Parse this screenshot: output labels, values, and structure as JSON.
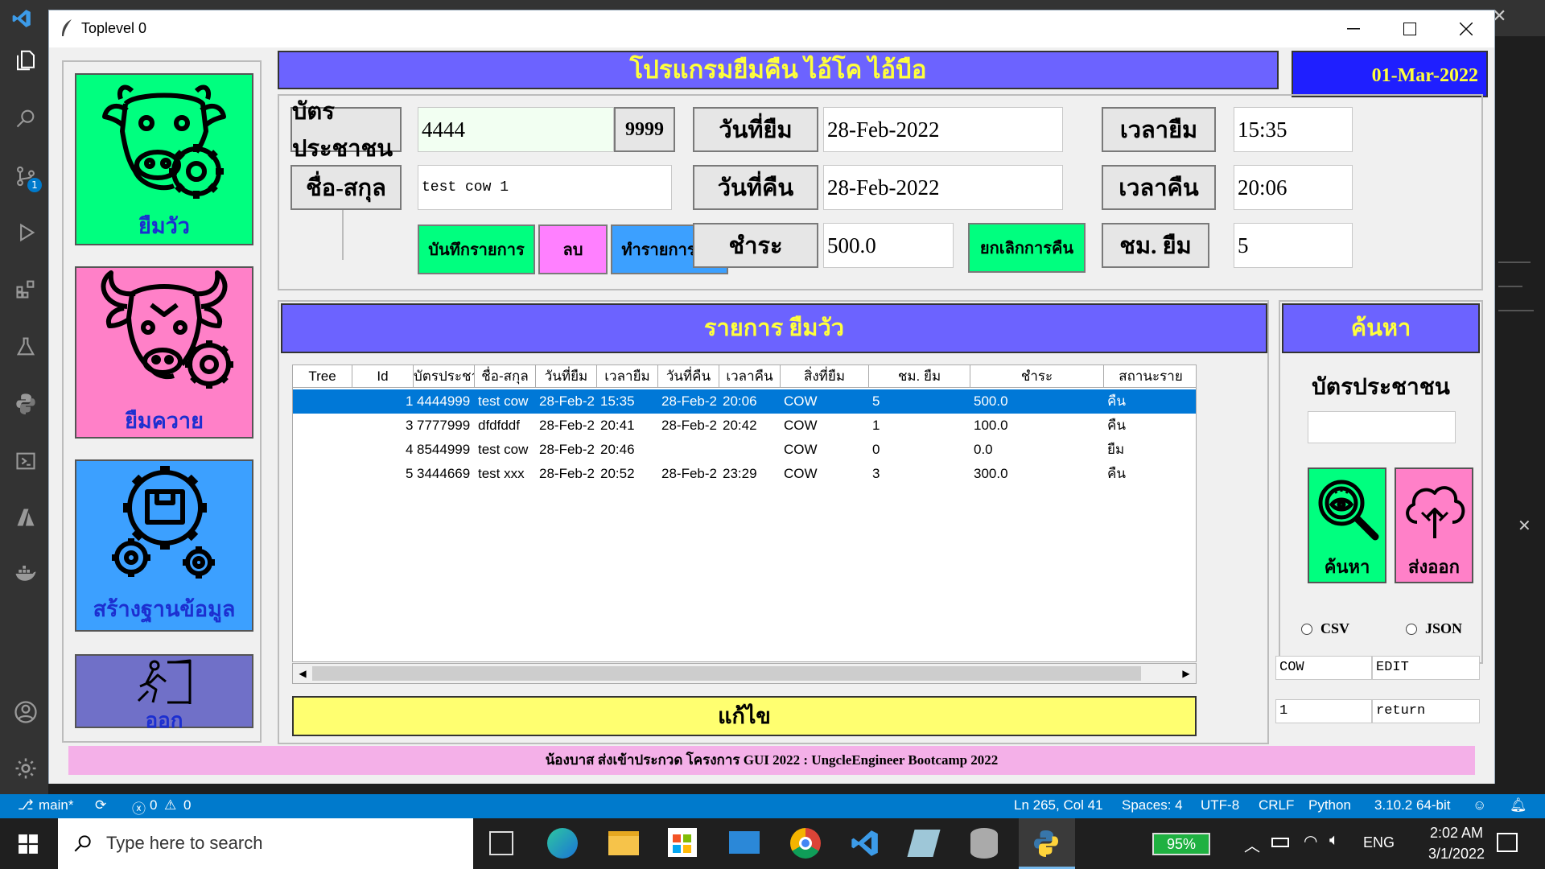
{
  "window": {
    "title": "Toplevel 0"
  },
  "nav": {
    "borrow_cow": "ยืมวัว",
    "borrow_buffalo": "ยืมควาย",
    "create_db": "สร้างฐานข้อมูล",
    "exit": "ออก"
  },
  "header": {
    "title": "โปรแกรมยืมคืน ไอ้โค ไอ้บือ",
    "date": "01-Mar-2022"
  },
  "form": {
    "id_card_label": "บัตรประชาชน",
    "id_card_value": "4444",
    "id_suffix": "9999",
    "name_label": "ชื่อ-สกุล",
    "name_value": "test cow 1",
    "borrow_date_label": "วันที่ยืม",
    "borrow_date_value": "28-Feb-2022",
    "return_date_label": "วันที่คืน",
    "return_date_value": "28-Feb-2022",
    "pay_label": "ชำระ",
    "pay_value": "500.0",
    "borrow_time_label": "เวลายืม",
    "borrow_time_value": "15:35",
    "return_time_label": "เวลาคืน",
    "return_time_value": "20:06",
    "hours_label": "ชม. ยืม",
    "hours_value": "5",
    "save_button": "บันทึกรายการ",
    "delete_button": "ลบ",
    "return_button": "ทำรายการคืน",
    "cancel_return_button": "ยกเลิกการคืน"
  },
  "list": {
    "title": "รายการ ยืมวัว",
    "columns": [
      "Tree",
      "Id",
      "บัตรประชา",
      "ชื่อ-สกุล",
      "วันที่ยืม",
      "เวลายืม",
      "วันที่คืน",
      "เวลาคืน",
      "สิ่งที่ยืม",
      "ชม. ยืม",
      "ชำระ",
      "สถานะราย"
    ],
    "rows": [
      {
        "id": "1",
        "card": "4444999",
        "name": "test cow",
        "bdate": "28-Feb-2",
        "btime": "15:35",
        "rdate": "28-Feb-2",
        "rtime": "20:06",
        "item": "COW",
        "hours": "5",
        "pay": "500.0",
        "status": "คืน"
      },
      {
        "id": "3",
        "card": "7777999",
        "name": "dfdfddf",
        "bdate": "28-Feb-2",
        "btime": "20:41",
        "rdate": "28-Feb-2",
        "rtime": "20:42",
        "item": "COW",
        "hours": "1",
        "pay": "100.0",
        "status": "คืน"
      },
      {
        "id": "4",
        "card": "8544999",
        "name": "test cow",
        "bdate": "28-Feb-2",
        "btime": "20:46",
        "rdate": "",
        "rtime": "",
        "item": "COW",
        "hours": "0",
        "pay": "0.0",
        "status": "ยืม"
      },
      {
        "id": "5",
        "card": "3444669",
        "name": "test xxx",
        "bdate": "28-Feb-2",
        "btime": "20:52",
        "rdate": "28-Feb-2",
        "rtime": "23:29",
        "item": "COW",
        "hours": "3",
        "pay": "300.0",
        "status": "คืน"
      }
    ],
    "edit_button": "แก้ไข"
  },
  "search": {
    "title": "ค้นหา",
    "id_label": "บัตรประชาชน",
    "id_value": "",
    "search_button": "ค้นหา",
    "export_button": "ส่งออก",
    "csv_label": "CSV",
    "json_label": "JSON",
    "cell1": "COW",
    "cell2": "EDIT",
    "cell3": "1",
    "cell4": "return"
  },
  "footer": "น้องบาส ส่งเข้าประกวด โครงการ GUI 2022 : UngcleEngineer Bootcamp 2022",
  "statusbar": {
    "branch": "main*",
    "errors": "0",
    "warnings": "0",
    "position": "Ln 265, Col 41",
    "spaces": "Spaces: 4",
    "encoding": "UTF-8",
    "eol": "CRLF",
    "language": "Python",
    "interpreter": "3.10.2 64-bit",
    "scm_badge": "1"
  },
  "taskbar": {
    "search_placeholder": "Type here to search",
    "battery": "95%",
    "lang": "ENG",
    "time": "2:02 AM",
    "date": "3/1/2022"
  },
  "colors": {
    "header_blue": "#6c63ff",
    "title_yellow": "#ffff3c",
    "green_button": "#00ff7f",
    "pink_button": "#ff80c8",
    "blue_button": "#3ca0ff",
    "exit_button": "#7070c8"
  }
}
